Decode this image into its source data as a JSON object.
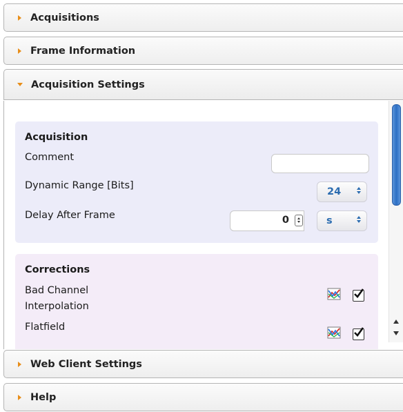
{
  "accordion": {
    "acquisitions": "Acquisitions",
    "frame_information": "Frame Information",
    "acquisition_settings": "Acquisition Settings",
    "web_client_settings": "Web Client Settings",
    "help": "Help"
  },
  "acquisition": {
    "title": "Acquisition",
    "comment_label": "Comment",
    "comment_value": "",
    "dynamic_range_label": "Dynamic Range [Bits]",
    "dynamic_range_value": "24",
    "delay_label": "Delay After Frame",
    "delay_value": "0",
    "delay_unit": "s"
  },
  "corrections": {
    "title": "Corrections",
    "bad_channel_label_line1": "Bad Channel",
    "bad_channel_label_line2": "Interpolation",
    "bad_channel_checked": true,
    "flatfield_label": "Flatfield",
    "flatfield_checked": true
  },
  "colors": {
    "arrow": "#e88e1a",
    "acquisition_panel": "#ececf9",
    "corrections_panel": "#f4ecf8",
    "select_text": "#2b6cb0",
    "scroll_thumb": "#2c6fc4"
  },
  "icons": {
    "collapsed": "triangle-right-icon",
    "expanded": "triangle-down-icon",
    "chart": "chart-icon",
    "checkbox": "checkmark-icon"
  }
}
